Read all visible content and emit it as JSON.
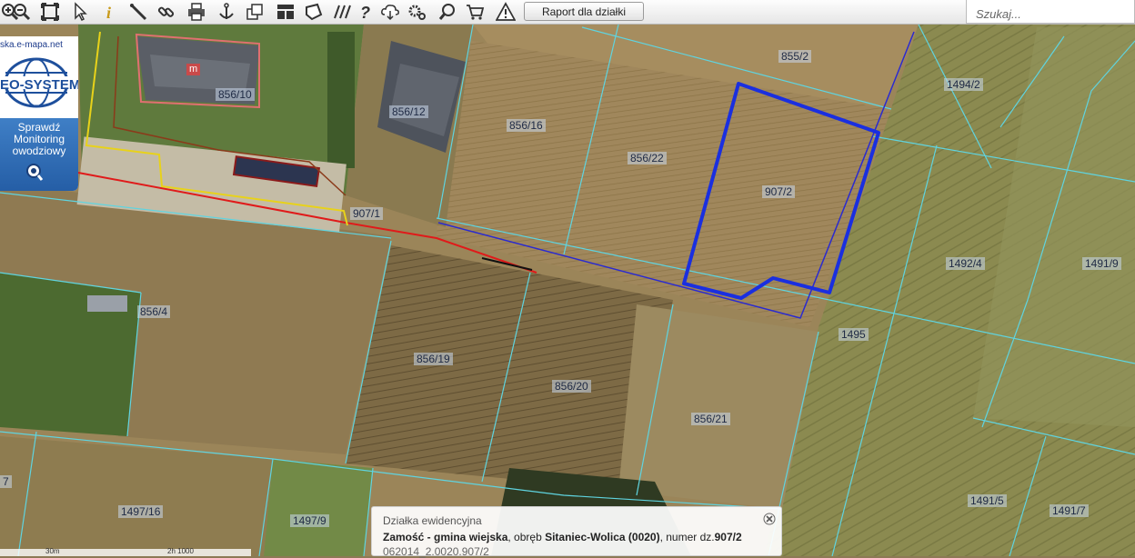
{
  "toolbar": {
    "report_button_label": "Raport dla działki",
    "search_placeholder": "Szukaj...",
    "tools": [
      {
        "name": "zoom-in-icon"
      },
      {
        "name": "zoom-out-icon"
      },
      {
        "name": "full-extent-icon"
      },
      {
        "name": "pointer-icon"
      },
      {
        "name": "info-icon"
      },
      {
        "name": "measure-distance-icon"
      },
      {
        "name": "link-icon"
      },
      {
        "name": "print-icon"
      },
      {
        "name": "anchor-icon"
      },
      {
        "name": "layers-icon"
      },
      {
        "name": "layout-icon"
      },
      {
        "name": "polygon-icon"
      },
      {
        "name": "hatch-icon"
      },
      {
        "name": "help-icon"
      },
      {
        "name": "cloud-download-icon"
      },
      {
        "name": "settings-icon"
      },
      {
        "name": "search-map-icon"
      },
      {
        "name": "cart-icon"
      },
      {
        "name": "warning-icon"
      }
    ]
  },
  "logo": {
    "url_text": "ska.e-mapa.net",
    "brand": "EO-SYSTEM",
    "lines": [
      "Sprawdź",
      "Monitoring",
      "owodziowy"
    ]
  },
  "map": {
    "building_marker": "m",
    "parcels": [
      {
        "id": "p-855-2",
        "label": "855/2"
      },
      {
        "id": "p-1494-2",
        "label": "1494/2"
      },
      {
        "id": "p-856-10",
        "label": "856/10"
      },
      {
        "id": "p-856-12",
        "label": "856/12"
      },
      {
        "id": "p-856-16",
        "label": "856/16"
      },
      {
        "id": "p-856-22",
        "label": "856/22"
      },
      {
        "id": "p-907-2",
        "label": "907/2"
      },
      {
        "id": "p-907-1",
        "label": "907/1"
      },
      {
        "id": "p-1492-4",
        "label": "1492/4"
      },
      {
        "id": "p-1491-9",
        "label": "1491/9"
      },
      {
        "id": "p-856-4",
        "label": "856/4"
      },
      {
        "id": "p-1495",
        "label": "1495"
      },
      {
        "id": "p-856-19",
        "label": "856/19"
      },
      {
        "id": "p-856-20",
        "label": "856/20"
      },
      {
        "id": "p-856-21",
        "label": "856/21"
      },
      {
        "id": "p-1497-16",
        "label": "1497/16"
      },
      {
        "id": "p-1497-9",
        "label": "1497/9"
      },
      {
        "id": "p-1491-5",
        "label": "1491/5"
      },
      {
        "id": "p-1491-7",
        "label": "1491/7"
      },
      {
        "id": "p-7",
        "label": "7"
      }
    ]
  },
  "infobox": {
    "title": "Działka ewidencyjna",
    "municipality": "Zamość - gmina wiejska",
    "precinct_prefix": ", obręb ",
    "precinct": "Sitaniec-Wolica (0020)",
    "number_prefix": ", numer dz.",
    "number": "907/2",
    "id_line": "062014_2.0020.907/2"
  },
  "scale": {
    "left_label": "30m",
    "right_label": "2h 1000"
  }
}
